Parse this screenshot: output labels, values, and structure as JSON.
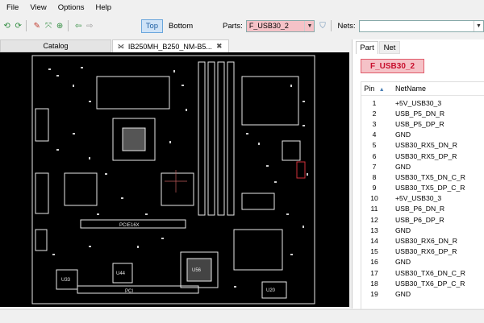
{
  "menu": [
    "File",
    "View",
    "Options",
    "Help"
  ],
  "toolbar": {
    "top_label": "Top",
    "bottom_label": "Bottom",
    "parts_label": "Parts:",
    "parts_value": "F_USB30_2",
    "nets_label": "Nets:",
    "nets_value": "",
    "icons": [
      "refresh-left-icon",
      "refresh-right-icon",
      "color-icon",
      "fit-icon",
      "zoom-icon",
      "back-icon",
      "forward-icon",
      "filter-icon"
    ]
  },
  "tabs": {
    "catalog": "Catalog",
    "document": "IB250MH_B250_NM-B5...",
    "close_glyph": "✖",
    "doc_icon_glyph": "⟗"
  },
  "board": {
    "labels": [
      "PCIE16X",
      "PCI",
      "U33",
      "U44",
      "U56",
      "U20"
    ]
  },
  "right": {
    "tabs": [
      "Part",
      "Net"
    ],
    "part_name": "F_USB30_2",
    "columns": {
      "pin": "Pin",
      "net": "NetName"
    },
    "rows": [
      {
        "pin": "1",
        "net": "+5V_USB30_3"
      },
      {
        "pin": "2",
        "net": "USB_P5_DN_R"
      },
      {
        "pin": "3",
        "net": "USB_P5_DP_R"
      },
      {
        "pin": "4",
        "net": "GND"
      },
      {
        "pin": "5",
        "net": "USB30_RX5_DN_R"
      },
      {
        "pin": "6",
        "net": "USB30_RX5_DP_R"
      },
      {
        "pin": "7",
        "net": "GND"
      },
      {
        "pin": "8",
        "net": "USB30_TX5_DN_C_R"
      },
      {
        "pin": "9",
        "net": "USB30_TX5_DP_C_R"
      },
      {
        "pin": "10",
        "net": "+5V_USB30_3"
      },
      {
        "pin": "11",
        "net": "USB_P6_DN_R"
      },
      {
        "pin": "12",
        "net": "USB_P6_DP_R"
      },
      {
        "pin": "13",
        "net": "GND"
      },
      {
        "pin": "14",
        "net": "USB30_RX6_DN_R"
      },
      {
        "pin": "15",
        "net": "USB30_RX6_DP_R"
      },
      {
        "pin": "16",
        "net": "GND"
      },
      {
        "pin": "17",
        "net": "USB30_TX6_DN_C_R"
      },
      {
        "pin": "18",
        "net": "USB30_TX6_DP_C_R"
      },
      {
        "pin": "19",
        "net": "GND"
      }
    ]
  },
  "colors": {
    "accent": "#1e5fa3",
    "part_highlight": "#f5c2c7",
    "part_text": "#c8102e",
    "board_bg": "#000000",
    "silkscreen": "#e8e8e8",
    "selection_marker": "#d0303a"
  }
}
